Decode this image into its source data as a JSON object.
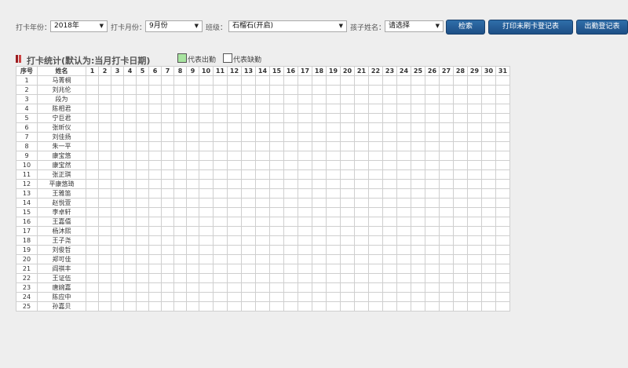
{
  "filters": {
    "year_label": "打卡年份：",
    "year_value": "2018年",
    "month_label": "打卡月份：",
    "month_value": "9月份",
    "class_label": "班级：",
    "class_value": "石榴石(开启)",
    "child_label": "孩子姓名：",
    "child_value": "请选择"
  },
  "buttons": {
    "search": "检索",
    "print_unswiped": "打印未刷卡登记表",
    "attendance": "出勤登记表"
  },
  "section": {
    "title": "打卡统计(默认为:当月打卡日期)",
    "legend_present": "代表出勤",
    "legend_absent": "代表缺勤"
  },
  "colors": {
    "button": "#1f558f",
    "present": "#a8e4a0",
    "absent": "#ffffff",
    "title_accent": "#9b1c20"
  },
  "table": {
    "headers": [
      "序号",
      "姓名"
    ],
    "days": [
      "1",
      "2",
      "3",
      "4",
      "5",
      "6",
      "7",
      "8",
      "9",
      "10",
      "11",
      "12",
      "13",
      "14",
      "15",
      "16",
      "17",
      "18",
      "19",
      "20",
      "21",
      "22",
      "23",
      "24",
      "25",
      "26",
      "27",
      "28",
      "29",
      "30",
      "31"
    ],
    "rows": [
      {
        "no": "1",
        "name": "马菁桐"
      },
      {
        "no": "2",
        "name": "刘兆伦"
      },
      {
        "no": "3",
        "name": "段为"
      },
      {
        "no": "4",
        "name": "陈相君"
      },
      {
        "no": "5",
        "name": "宁巨君"
      },
      {
        "no": "6",
        "name": "张昕仪"
      },
      {
        "no": "7",
        "name": "刘佳扬"
      },
      {
        "no": "8",
        "name": "朱一平"
      },
      {
        "no": "9",
        "name": "康宝悠"
      },
      {
        "no": "10",
        "name": "康宝然"
      },
      {
        "no": "11",
        "name": "张正琪"
      },
      {
        "no": "12",
        "name": "平康悠琦"
      },
      {
        "no": "13",
        "name": "王雅笛"
      },
      {
        "no": "14",
        "name": "赵悦萱"
      },
      {
        "no": "15",
        "name": "李卓轩"
      },
      {
        "no": "16",
        "name": "王嘉僖"
      },
      {
        "no": "17",
        "name": "杨沐熙"
      },
      {
        "no": "18",
        "name": "王子尧"
      },
      {
        "no": "19",
        "name": "刘俊哲"
      },
      {
        "no": "20",
        "name": "郑可佳"
      },
      {
        "no": "21",
        "name": "阎祺丰"
      },
      {
        "no": "22",
        "name": "王证伍"
      },
      {
        "no": "23",
        "name": "唐婉嘉"
      },
      {
        "no": "24",
        "name": "陈应中"
      },
      {
        "no": "25",
        "name": "孙嘉贝"
      }
    ]
  }
}
